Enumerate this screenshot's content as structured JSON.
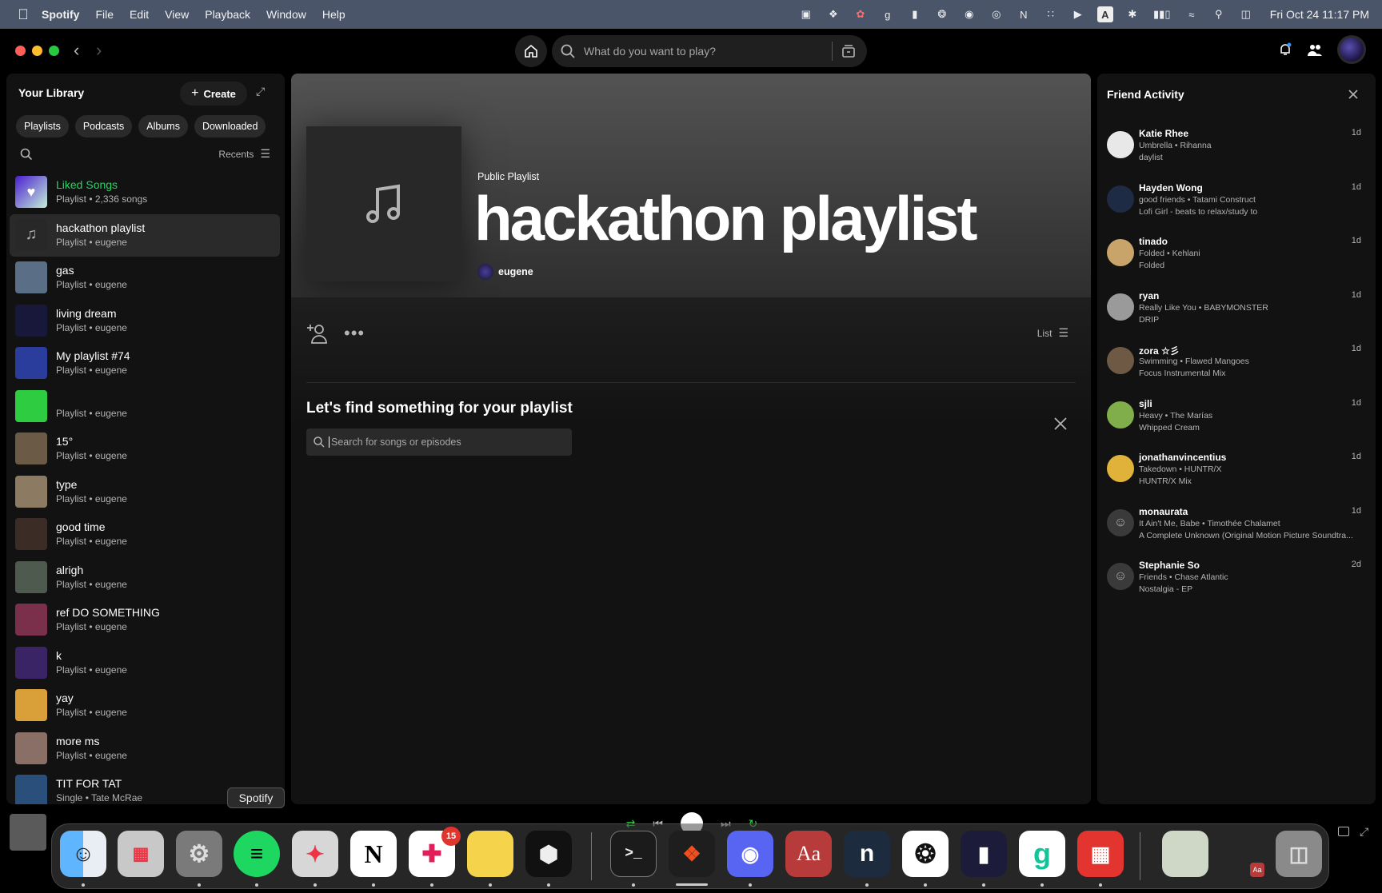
{
  "menubar": {
    "app_name": "Spotify",
    "menus": [
      "File",
      "Edit",
      "View",
      "Playback",
      "Window",
      "Help"
    ],
    "clock": "Fri Oct 24  11:17 PM"
  },
  "search": {
    "placeholder": "What do you want to play?"
  },
  "library": {
    "title": "Your Library",
    "create_label": "Create",
    "filters": [
      "Playlists",
      "Podcasts",
      "Albums",
      "Downloaded"
    ],
    "sort_label": "Recents",
    "items": [
      {
        "title": "Liked Songs",
        "subtitle": "Playlist • 2,336 songs",
        "color": "#5b2bc4"
      },
      {
        "title": "hackathon playlist",
        "subtitle": "Playlist • eugene",
        "color": "#282828"
      },
      {
        "title": "gas",
        "subtitle": "Playlist • eugene",
        "color": "#5a6f86"
      },
      {
        "title": "living dream",
        "subtitle": "Playlist • eugene",
        "color": "#17183a"
      },
      {
        "title": "My playlist #74",
        "subtitle": "Playlist • eugene",
        "color": "#2b3d9c"
      },
      {
        "title": "",
        "subtitle": "Playlist • eugene",
        "color": "#2ecc40"
      },
      {
        "title": "15°",
        "subtitle": "Playlist • eugene",
        "color": "#6b5a45"
      },
      {
        "title": "type",
        "subtitle": "Playlist • eugene",
        "color": "#8c7a62"
      },
      {
        "title": "good time",
        "subtitle": "Playlist • eugene",
        "color": "#3b2d26"
      },
      {
        "title": "alrigh",
        "subtitle": "Playlist • eugene",
        "color": "#4f5a4e"
      },
      {
        "title": "ref DO SOMETHING",
        "subtitle": "Playlist • eugene",
        "color": "#7a2f4a"
      },
      {
        "title": "k",
        "subtitle": "Playlist • eugene",
        "color": "#3a2466"
      },
      {
        "title": "yay",
        "subtitle": "Playlist • eugene",
        "color": "#d9a03a"
      },
      {
        "title": "more ms",
        "subtitle": "Playlist • eugene",
        "color": "#8a6f66"
      },
      {
        "title": "TIT FOR TAT",
        "subtitle": "Single • Tate McRae",
        "color": "#2a4f7a"
      }
    ]
  },
  "playlist": {
    "type_label": "Public Playlist",
    "title": "hackathon playlist",
    "owner": "eugene",
    "view_label": "List",
    "find_heading": "Let's find something for your playlist",
    "find_placeholder": "Search for songs or episodes"
  },
  "friends": {
    "title": "Friend Activity",
    "items": [
      {
        "name": "Katie Rhee",
        "song": "Umbrella • Rihanna",
        "context": "daylist",
        "time": "1d",
        "color": "#e8e8e8"
      },
      {
        "name": "Hayden Wong",
        "song": "good friends • Tatami Construct",
        "context": "Lofi Girl - beats to relax/study to",
        "time": "1d",
        "color": "#1e2b44"
      },
      {
        "name": "tinado",
        "song": "Folded • Kehlani",
        "context": "Folded",
        "time": "1d",
        "color": "#c9a46a"
      },
      {
        "name": "ryan",
        "song": "Really Like You • BABYMONSTER",
        "context": "DRIP",
        "time": "1d",
        "color": "#9a9a9a"
      },
      {
        "name": "zora ☆彡",
        "song": "Swimming • Flawed Mangoes",
        "context": "Focus Instrumental Mix",
        "time": "1d",
        "color": "#6e5a44"
      },
      {
        "name": "sjli",
        "song": "Heavy • The Marías",
        "context": "Whipped Cream",
        "time": "1d",
        "color": "#7fae4a"
      },
      {
        "name": "jonathanvincentius",
        "song": "Takedown • HUNTR/X",
        "context": "HUNTR/X Mix",
        "time": "1d",
        "color": "#e0b23a"
      },
      {
        "name": "monaurata",
        "song": "It Ain't Me, Babe • Timothée Chalamet",
        "context": "A Complete Unknown (Original Motion Picture Soundtra...",
        "time": "1d",
        "color": "#3a3a3a"
      },
      {
        "name": "Stephanie So",
        "song": "Friends • Chase Atlantic",
        "context": "Nostalgia - EP",
        "time": "2d",
        "color": "#3a3a3a"
      }
    ]
  },
  "dock": {
    "tooltip": "Spotify",
    "slack_badge": "15"
  }
}
